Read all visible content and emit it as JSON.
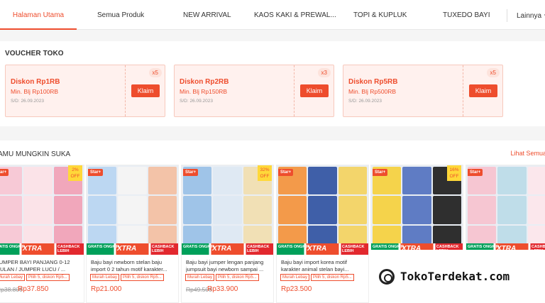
{
  "nav": {
    "items": [
      {
        "label": "Halaman Utama",
        "active": true
      },
      {
        "label": "Semua Produk",
        "active": false
      },
      {
        "label": "NEW ARRIVAL",
        "active": false
      },
      {
        "label": "KAOS KAKI & PREWAL...",
        "active": false
      },
      {
        "label": "TOPI & KUPLUK",
        "active": false
      },
      {
        "label": "TUXEDO BAYI",
        "active": false
      }
    ],
    "more_label": "Lainnya"
  },
  "voucher_section": {
    "title": "VOUCHER TOKO",
    "vouchers": [
      {
        "title": "Diskon Rp1RB",
        "min": "Min. Blj Rp100RB",
        "date": "S/D: 26.09.2023",
        "qty": "x5",
        "button": "Klaim"
      },
      {
        "title": "Diskon Rp2RB",
        "min": "Min. Blj Rp150RB",
        "date": "S/D: 26.09.2023",
        "qty": "x3",
        "button": "Klaim"
      },
      {
        "title": "Diskon Rp5RB",
        "min": "Min. Blj Rp500RB",
        "date": "S/D: 26.09.2023",
        "qty": "x5",
        "button": "Klaim"
      }
    ]
  },
  "recommendations": {
    "title": "AMU MUNGKIN SUKA",
    "see_all": "Lihat Semua",
    "products": [
      {
        "name": "JUMPER BAYI PANJANG 0-12 BULAN / JUMPER LUCU / ...",
        "star": "Star+",
        "discount": "2%",
        "off": "OFF",
        "tag1": "Murah Lebay",
        "tag2": "Pilih 5, diskon Rp5...",
        "old_price": "Rp38.800",
        "price": "Rp37.850",
        "palette": [
          "#f7c9d6",
          "#fbe3e8",
          "#f1a7bb"
        ]
      },
      {
        "name": "Baju bayi newborn stelan baju import 0 2 tahun motif karakter...",
        "star": "Star+",
        "discount": "",
        "off": "",
        "tag1": "Murah Lebay",
        "tag2": "Pilih 5, diskon Rp5...",
        "old_price": "",
        "price": "Rp21.000",
        "palette": [
          "#bcd7f2",
          "#f4f4f4",
          "#f3c3a8"
        ]
      },
      {
        "name": "Baju bayi jumper lengan panjang jumpsuit bayi newborn sampai ...",
        "star": "Star+",
        "discount": "32%",
        "off": "OFF",
        "tag1": "Murah Lebay",
        "tag2": "Pilih 5, diskon Rp5...",
        "old_price": "Rp49.500",
        "price": "Rp33.900",
        "palette": [
          "#9fc4e8",
          "#dfe9f3",
          "#f1e0b5"
        ]
      },
      {
        "name": "Baju bayi import korea motif karakter animal stelan bayi...",
        "star": "Star+",
        "discount": "",
        "off": "",
        "tag1": "Murah Lebay",
        "tag2": "Pilih 5, diskon Rp5...",
        "old_price": "",
        "price": "Rp23.500",
        "palette": [
          "#f39a4a",
          "#3f5fa8",
          "#f3d56b"
        ]
      },
      {
        "name": "",
        "star": "Star+",
        "discount": "16%",
        "off": "OFF",
        "tag1": "",
        "tag2": "",
        "old_price": "",
        "price": "",
        "palette": [
          "#f5d34b",
          "#5f7cc4",
          "#2f2f2f"
        ]
      },
      {
        "name": "",
        "star": "Star+",
        "discount": "",
        "off": "",
        "tag1": "",
        "tag2": "",
        "old_price": "",
        "price": "",
        "palette": [
          "#f6c6d2",
          "#bfdde9",
          "#fbe7ec"
        ]
      }
    ],
    "strip": {
      "left": "GRATIS ONGKIR",
      "center": "XTRA",
      "right": "CASHBACK LEBIH"
    }
  },
  "watermark": "TokoTerdekat.com"
}
